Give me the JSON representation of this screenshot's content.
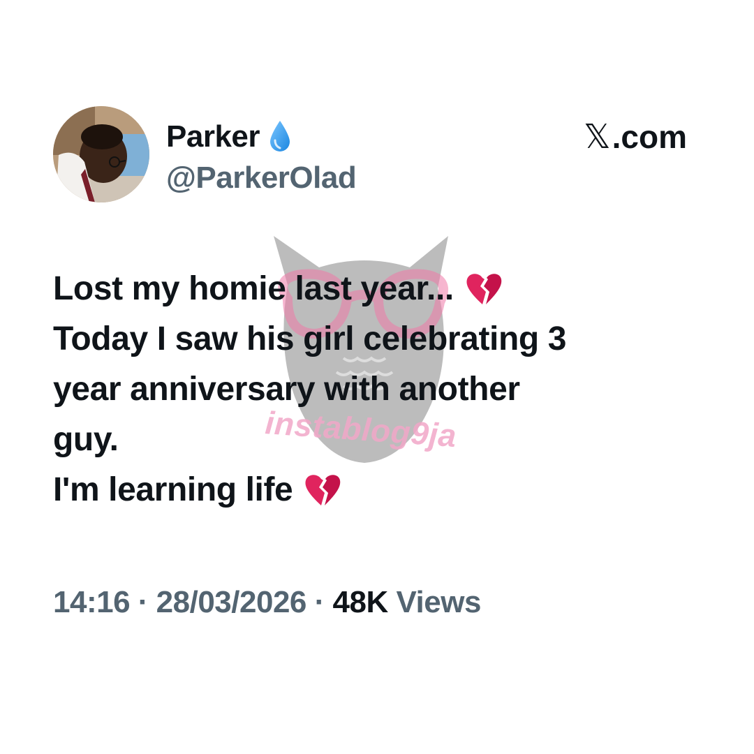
{
  "author": {
    "display_name": "Parker",
    "handle": "@ParkerOlad",
    "badge_icon": "water-drop-icon"
  },
  "brand": {
    "x_glyph": "𝕏",
    "domain": ".com"
  },
  "tweet": {
    "lines": [
      "Lost my homie last year...",
      "Today I saw his girl celebrating 3",
      "year anniversary with another",
      "guy.",
      "I'm learning life"
    ],
    "emoji": "broken-heart-icon"
  },
  "meta": {
    "time": "14:16",
    "separator": "·",
    "date": "28/03/2026",
    "views_count": "48K",
    "views_label": "Views"
  },
  "watermark": {
    "text": "instablog9ja"
  },
  "colors": {
    "text_primary": "#0f1419",
    "text_secondary": "#536471",
    "drop_blue": "#1d9bf0",
    "heart_red": "#e0245e",
    "watermark_pink": "#f2a8c8"
  }
}
